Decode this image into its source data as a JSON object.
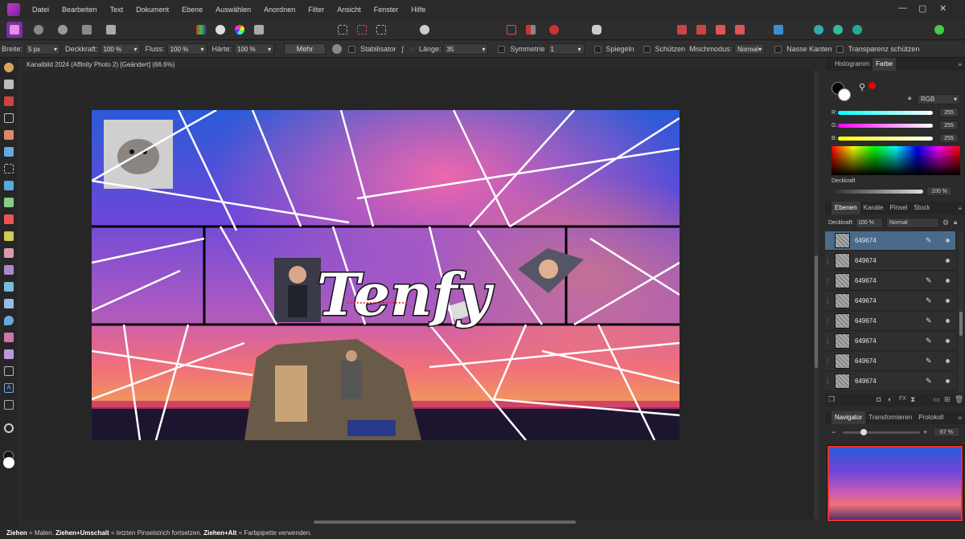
{
  "app": {
    "menus": [
      "Datei",
      "Bearbeiten",
      "Text",
      "Dokument",
      "Ebene",
      "Auswählen",
      "Anordnen",
      "Filter",
      "Ansicht",
      "Fenster",
      "Hilfe"
    ],
    "window_controls": [
      "—",
      "▢",
      "✕"
    ]
  },
  "context": {
    "breite_label": "Breite:",
    "breite_value": "5 px",
    "deckkraft_label": "Deckkraft:",
    "deckkraft_value": "100 %",
    "fluss_label": "Fluss:",
    "fluss_value": "100 %",
    "haerte_label": "Härte:",
    "haerte_value": "100 %",
    "mehr": "Mehr",
    "stabilisator": "Stabilisator",
    "laenge_label": "Länge:",
    "laenge_value": "35",
    "symmetrie": "Symmetrie",
    "symmetrie_value": "1",
    "spiegeln": "Spiegeln",
    "schuetzen": "Schützen",
    "mischmodus_label": "Mischmodus:",
    "mischmodus_value": "Normal",
    "nasse_kanten": "Nasse Kanten",
    "transparenz": "Transparenz schützen"
  },
  "document": {
    "tab_title": "Kanalbild 2024 (Affinity Photo 2) [Geändert] (66.6%)",
    "title_text": "Tenfy"
  },
  "colors": {
    "accent": "#4a6a8c",
    "bg": "#2b2b2b"
  },
  "panels": {
    "top_tabs": [
      "Histogramm",
      "Farbe"
    ],
    "color_model": "RGB",
    "r_label": "R:",
    "g_label": "G:",
    "b_label": "B:",
    "r": "255",
    "g": "255",
    "b": "255",
    "deckkraft_label": "Deckkraft",
    "deckkraft_value": "100 %",
    "layer_tabs": [
      "Ebenen",
      "Kanäle",
      "Pinsel",
      "Stock"
    ],
    "layer_opacity_label": "Deckkraft:",
    "layer_opacity": "100 %",
    "blend": "Normal",
    "layers": [
      {
        "name": "649674"
      },
      {
        "name": "649674"
      },
      {
        "name": "649674"
      },
      {
        "name": "649674"
      },
      {
        "name": "649674"
      },
      {
        "name": "649674"
      },
      {
        "name": "649674"
      },
      {
        "name": "649674"
      }
    ],
    "nav_tabs": [
      "Navigator",
      "Transformieren",
      "Protokoll"
    ],
    "zoom": "67 %"
  },
  "status": {
    "s1": "Ziehen",
    "t1": " = Malen. ",
    "s2": "Ziehen",
    "s3": "+Umschalt",
    "t2": " = letzten Pinselstrich fortsetzen. ",
    "s4": "Ziehen",
    "s5": "+Alt",
    "t3": " = Farbpipette verwenden."
  }
}
